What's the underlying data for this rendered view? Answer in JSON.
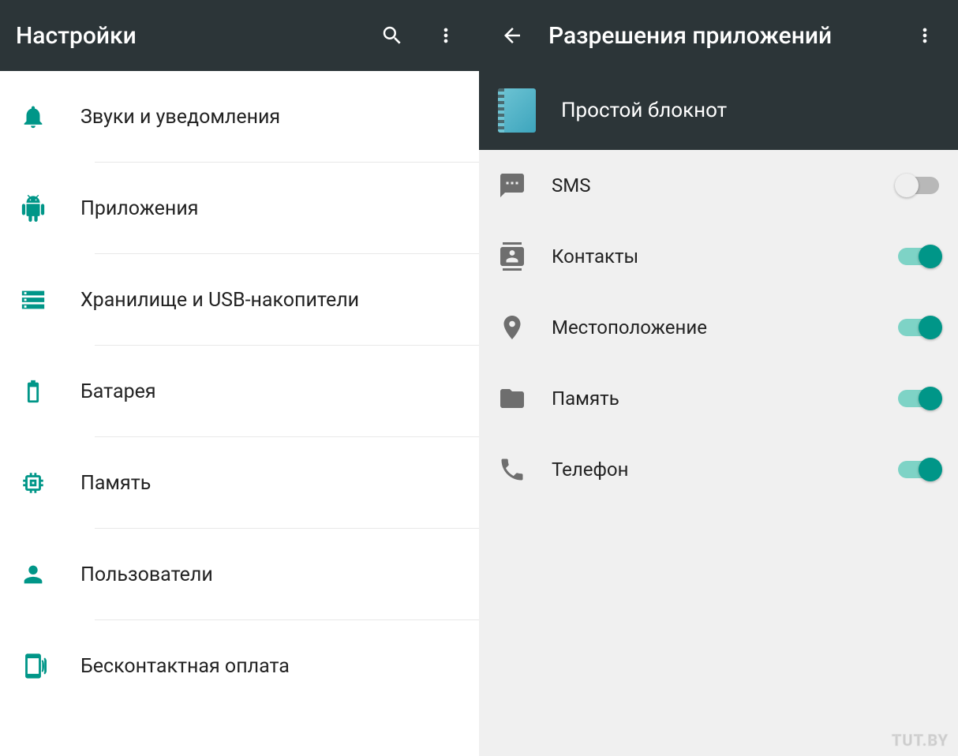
{
  "left": {
    "title": "Настройки",
    "items": [
      {
        "label": "Звуки и уведомления",
        "icon": "bell"
      },
      {
        "label": "Приложения",
        "icon": "android"
      },
      {
        "label": "Хранилище и USB-накопители",
        "icon": "storage"
      },
      {
        "label": "Батарея",
        "icon": "battery"
      },
      {
        "label": "Память",
        "icon": "memory"
      },
      {
        "label": "Пользователи",
        "icon": "person"
      },
      {
        "label": "Бесконтактная оплата",
        "icon": "taptopay"
      }
    ]
  },
  "right": {
    "title": "Разрешения приложений",
    "app_name": "Простой блокнот",
    "permissions": [
      {
        "label": "SMS",
        "icon": "sms",
        "enabled": false
      },
      {
        "label": "Контакты",
        "icon": "contacts",
        "enabled": true
      },
      {
        "label": "Местоположение",
        "icon": "location",
        "enabled": true
      },
      {
        "label": "Память",
        "icon": "folder",
        "enabled": true
      },
      {
        "label": "Телефон",
        "icon": "phone",
        "enabled": true
      }
    ]
  },
  "watermark": "TUT.BY"
}
